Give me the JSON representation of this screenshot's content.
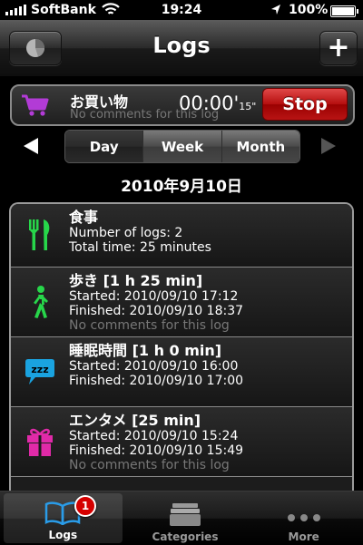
{
  "status_bar": {
    "carrier": "SoftBank",
    "time": "19:24",
    "battery": "100%",
    "icons": [
      "signal-icon",
      "wifi-icon",
      "location-icon",
      "battery-icon"
    ]
  },
  "nav": {
    "title": "Logs",
    "left_icon": "pie-chart-icon",
    "right_label": "+"
  },
  "timer": {
    "name": "お買い物",
    "comment": "No comments for this log",
    "time_main": "00:00'",
    "time_sec": "15\"",
    "stop_label": "Stop",
    "icon": "shopping-cart-icon",
    "icon_color": "#b23bd6"
  },
  "segments": {
    "items": [
      "Day",
      "Week",
      "Month"
    ],
    "selected": "Day"
  },
  "date_title": "2010年9月10日",
  "logs": [
    {
      "title": "食事",
      "lines": [
        "Number of logs: 2",
        "Total time: 25 minutes"
      ],
      "icon": "fork-knife-icon",
      "icon_color": "#27d64a"
    },
    {
      "title": "歩き [1 h 25 min]",
      "lines": [
        "Started: 2010/09/10 17:12",
        "Finished: 2010/09/10 18:37"
      ],
      "comment": "No comments for this log",
      "icon": "walking-person-icon",
      "icon_color": "#27d64a"
    },
    {
      "title": "睡眠時間 [1 h 0 min]",
      "lines": [
        "Started: 2010/09/10 16:00",
        "Finished: 2010/09/10 17:00"
      ],
      "icon": "sleep-bubble-icon",
      "icon_color": "#1aa3e0"
    },
    {
      "title": "エンタメ [25 min]",
      "lines": [
        "Started: 2010/09/10 15:24",
        "Finished: 2010/09/10 15:49"
      ],
      "comment": "No comments for this log",
      "icon": "gift-icon",
      "icon_color": "#e02aa8"
    }
  ],
  "tabs": [
    {
      "label": "Logs",
      "icon": "book-icon",
      "badge": "1"
    },
    {
      "label": "Categories",
      "icon": "box-icon"
    },
    {
      "label": "More",
      "icon": "more-dots-icon"
    }
  ]
}
